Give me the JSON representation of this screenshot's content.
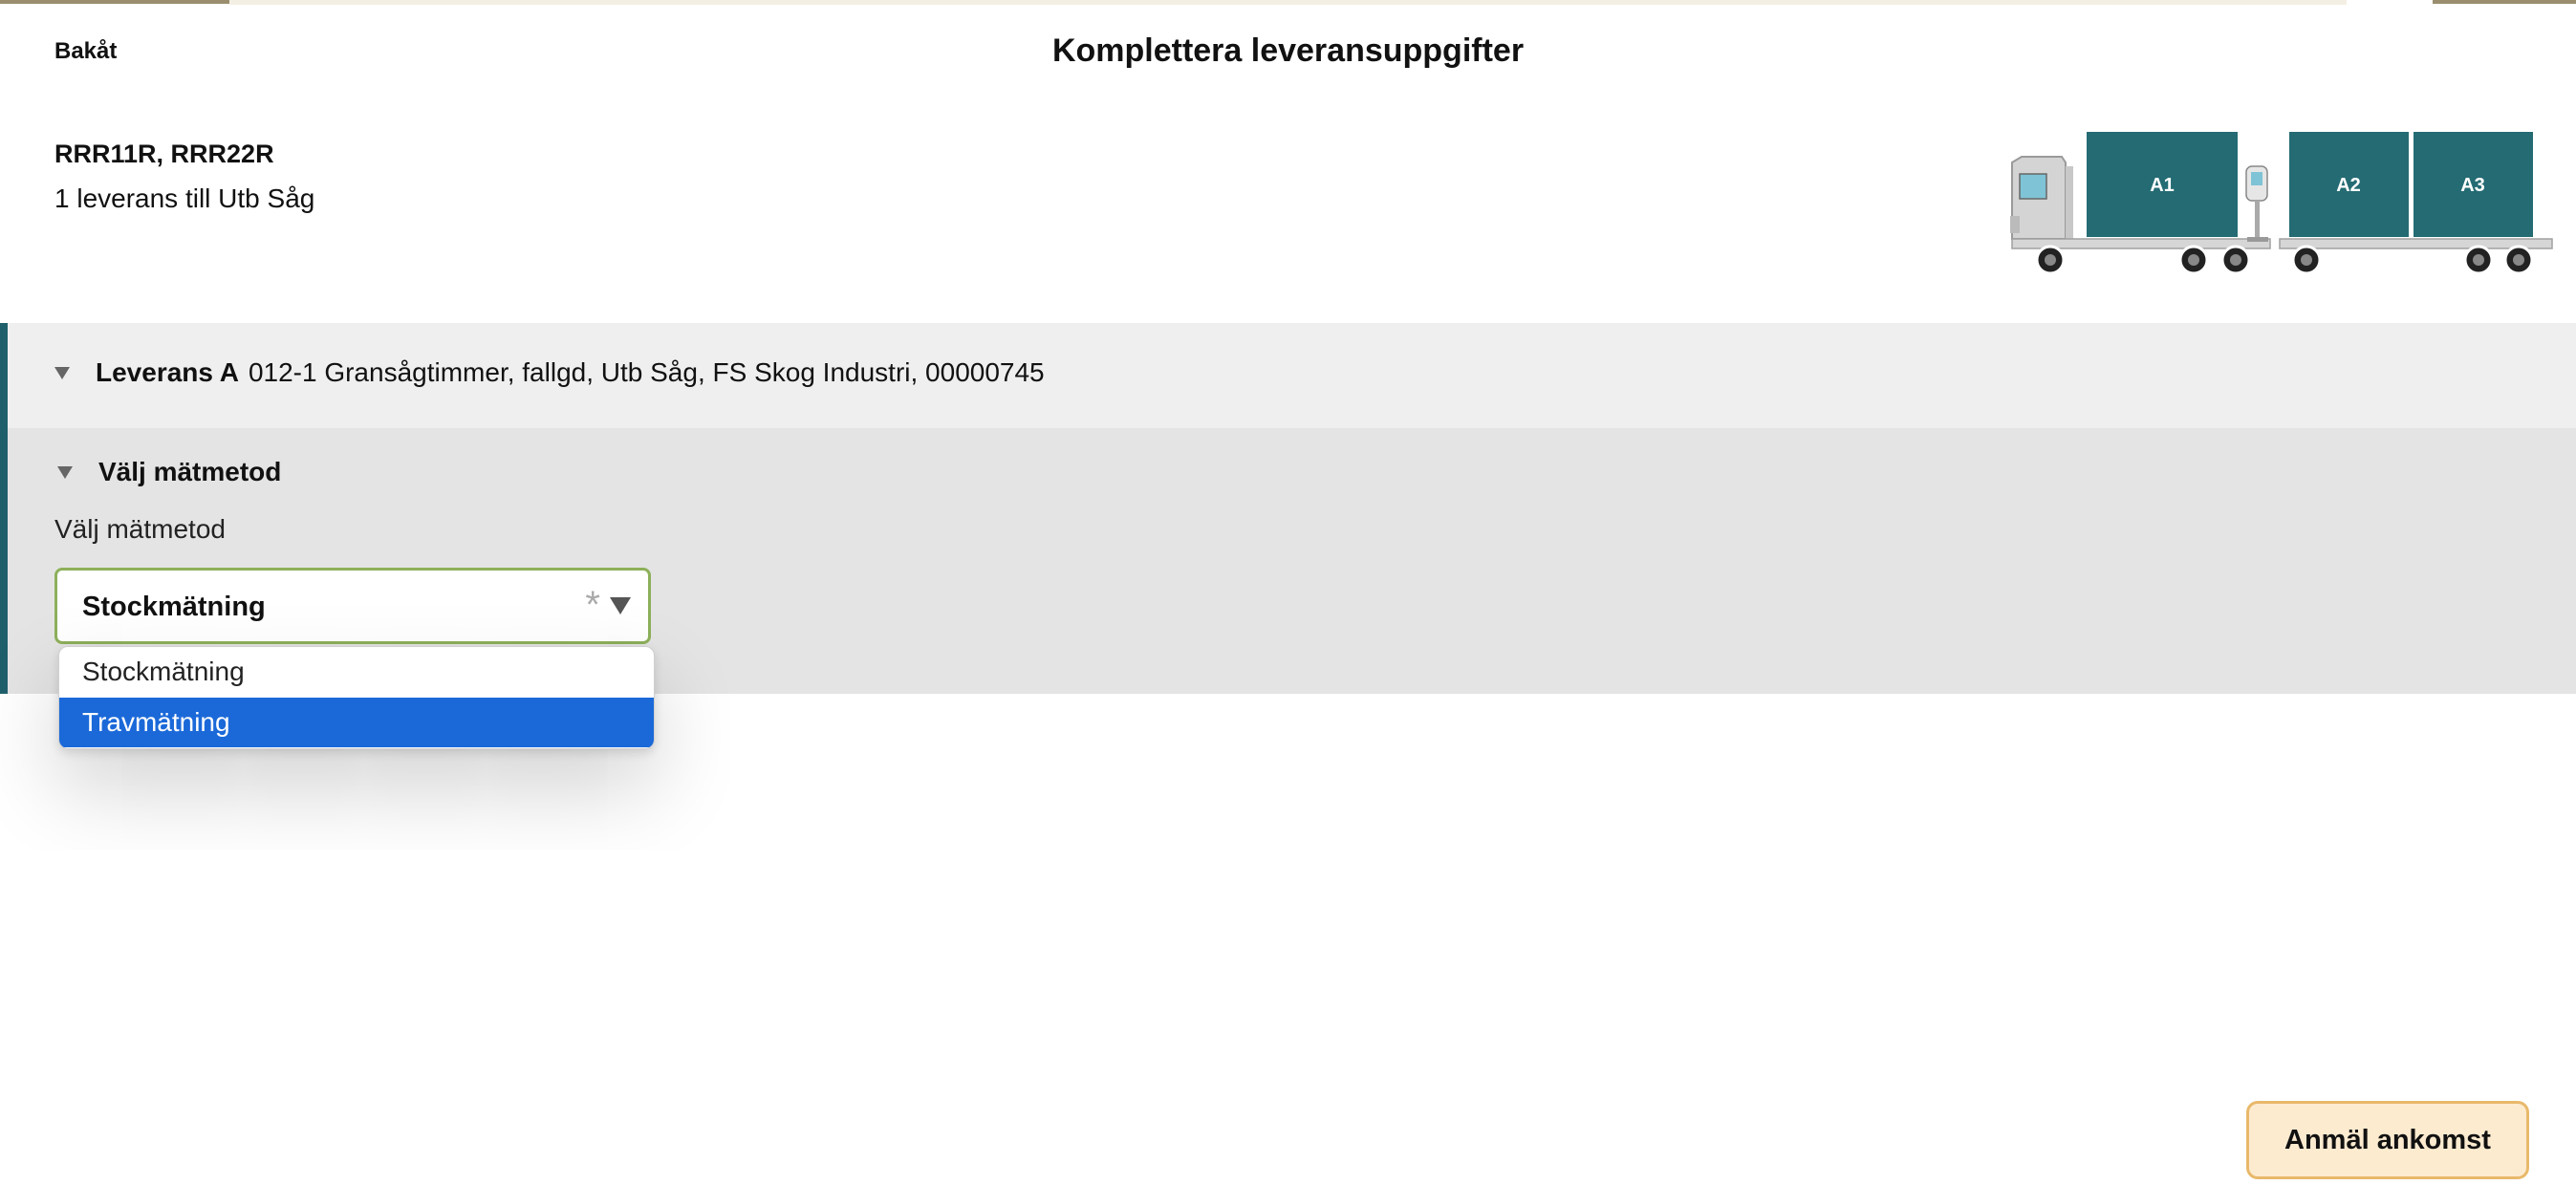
{
  "header": {
    "back_label": "Bakåt",
    "title": "Komplettera leveransuppgifter"
  },
  "vehicle": {
    "registration": "RRR11R, RRR22R",
    "delivery_summary": "1 leverans till Utb Såg",
    "compartments": [
      "A1",
      "A2",
      "A3"
    ],
    "compartment_color": "#246b73"
  },
  "delivery": {
    "label": "Leverans A",
    "description": "012-1 Gransågtimmer, fallgd, Utb Såg, FS Skog Industri, 00000745"
  },
  "measurement": {
    "section_title": "Välj mätmetod",
    "field_label": "Välj mätmetod",
    "selected_value": "Stockmätning",
    "required_marker": "*",
    "options": [
      "Stockmätning",
      "Travmätning"
    ],
    "highlighted_option": "Travmätning"
  },
  "actions": {
    "submit_label": "Anmäl ankomst"
  },
  "colors": {
    "accent_bar": "#1f5f6c",
    "select_border": "#8db05a",
    "highlight": "#1b69d9",
    "button_bg": "#fdebd0",
    "button_border": "#e8b96a"
  }
}
